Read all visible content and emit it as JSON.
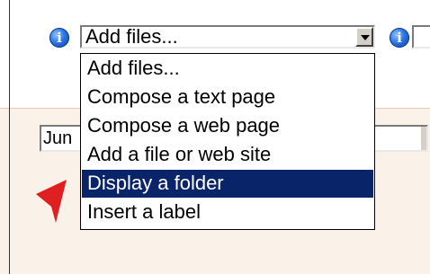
{
  "toolbar": {
    "add_files_select": {
      "value": "Add files...",
      "info_icon": "info-icon"
    },
    "right_info_icon": "info-icon"
  },
  "dropdown": {
    "options": [
      "Add files...",
      "Compose a text page",
      "Compose a web page",
      "Add a file or web site",
      "Display a folder",
      "Insert a label"
    ],
    "selected_index": 4,
    "selected_color": "#0a246a"
  },
  "secondary_select": {
    "value": "Jun"
  },
  "cursor": {
    "icon": "arrow-cursor-icon",
    "color": "#e02020"
  }
}
